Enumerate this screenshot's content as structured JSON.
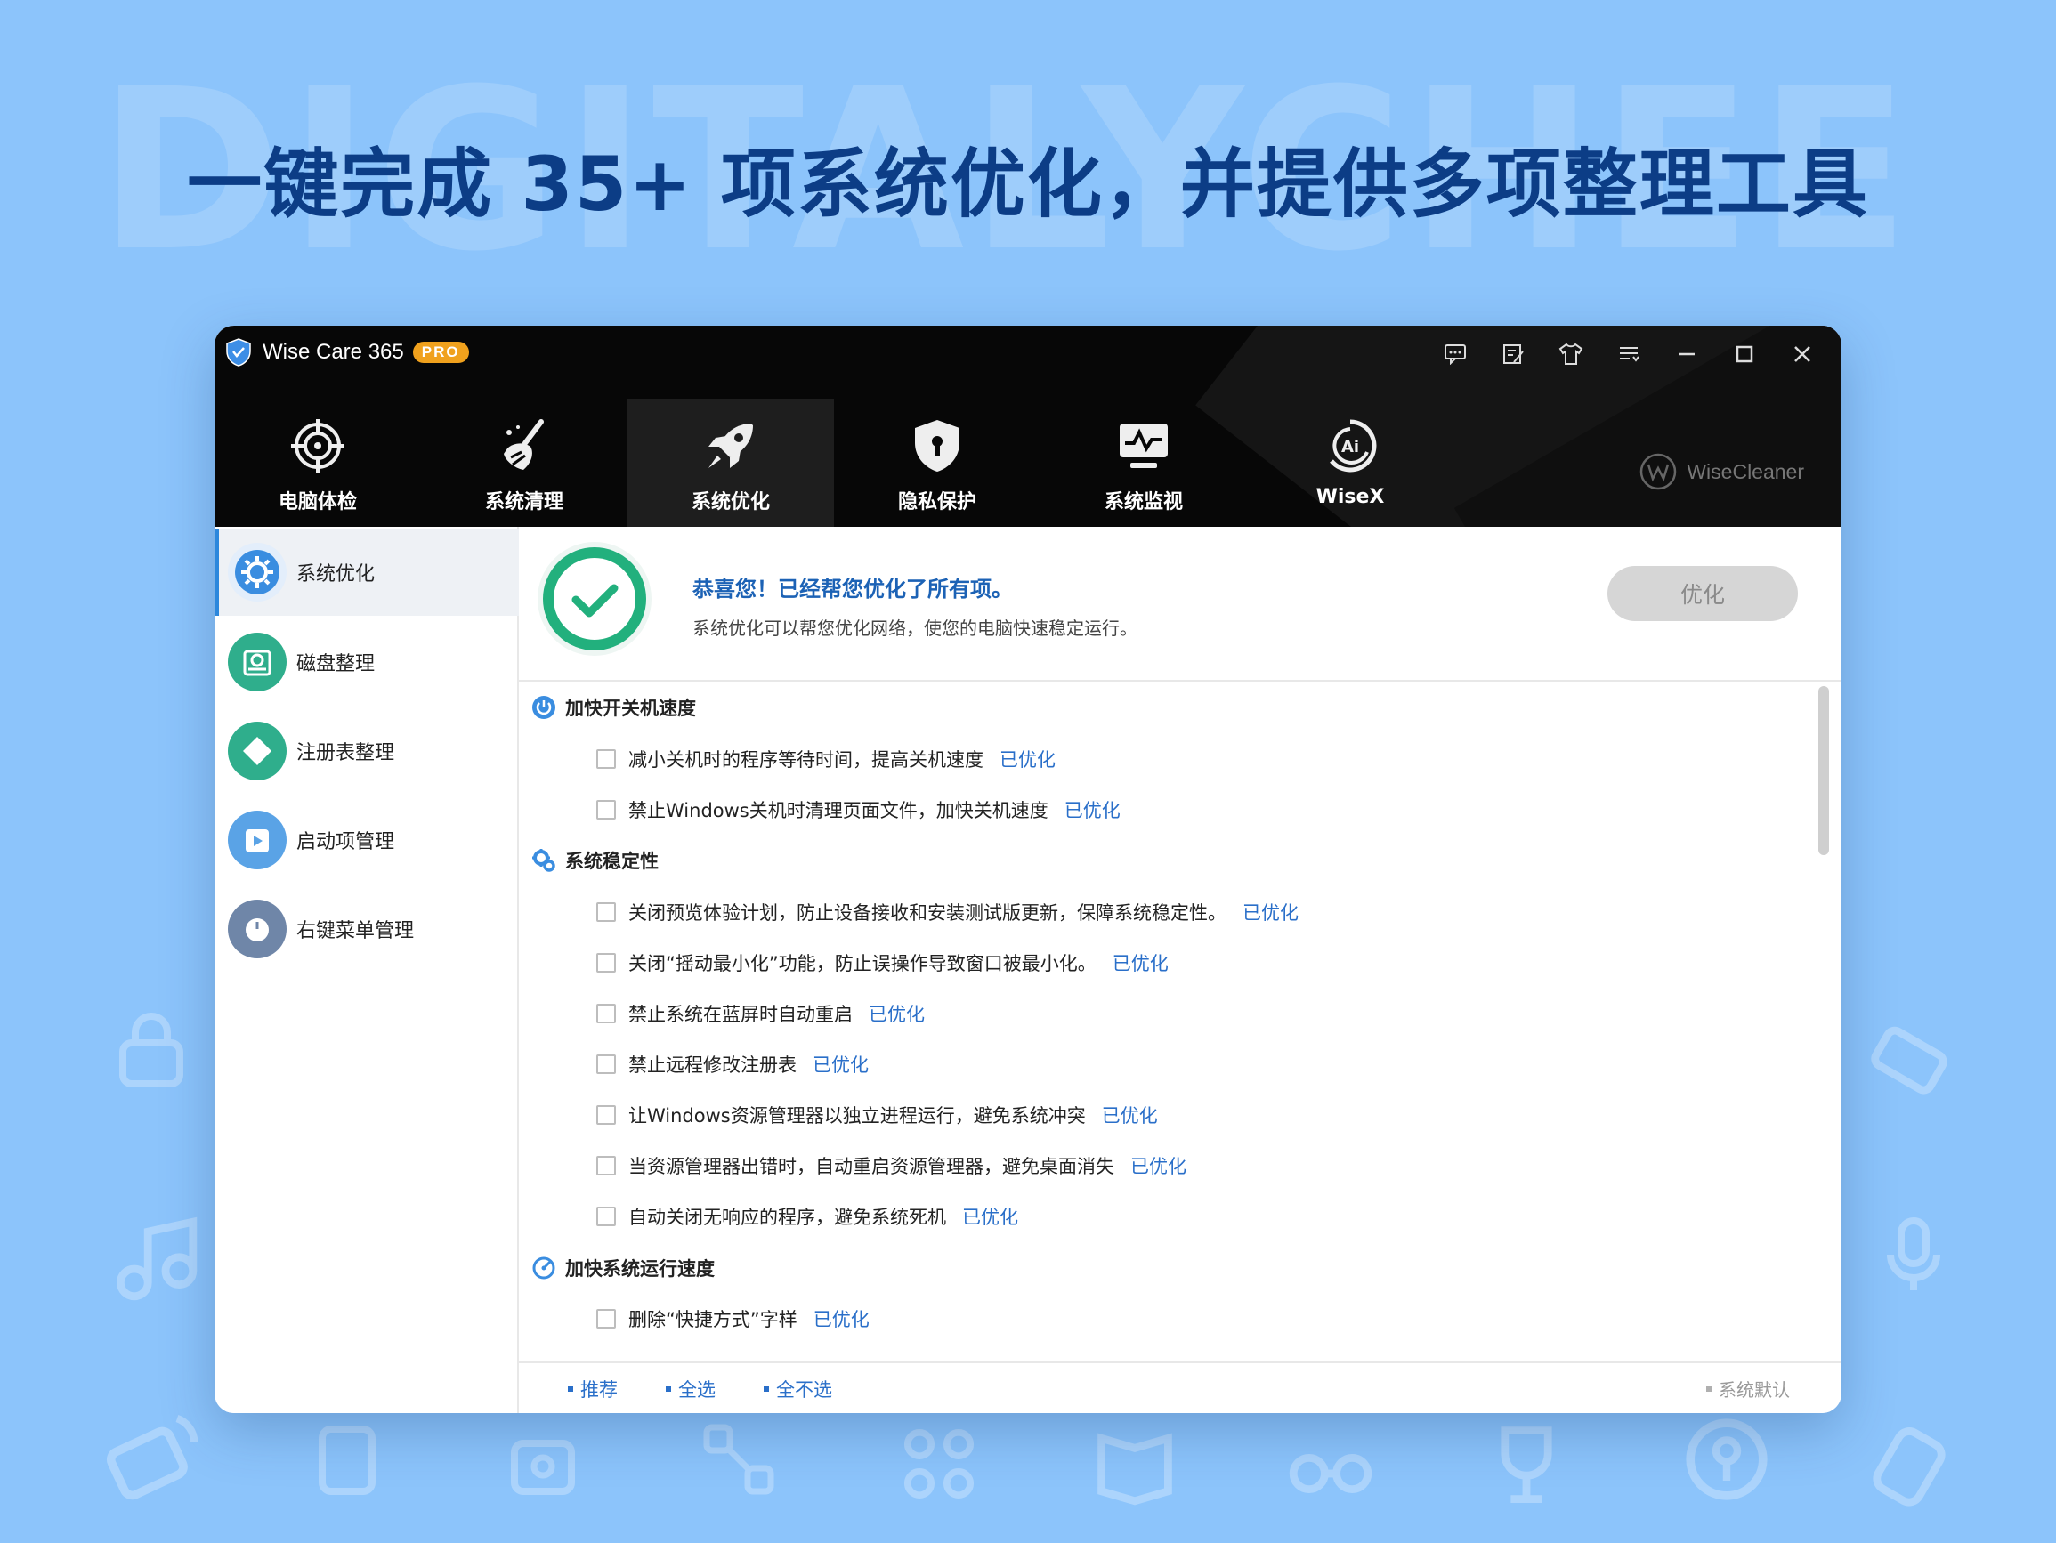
{
  "page": {
    "watermark": "DIGITALYCHEE",
    "headline": "一键完成 35+ 项系统优化，并提供多项整理工具"
  },
  "window": {
    "title": "Wise Care 365",
    "badge": "PRO",
    "controls": [
      "feedback-icon",
      "note-icon",
      "skin-icon",
      "menu-icon",
      "minimize-icon",
      "maximize-icon",
      "close-icon"
    ],
    "brand_logo_text": "WiseCleaner"
  },
  "nav": {
    "tabs": [
      {
        "label": "电脑体检",
        "icon": "target-icon"
      },
      {
        "label": "系统清理",
        "icon": "broom-icon"
      },
      {
        "label": "系统优化",
        "icon": "rocket-icon",
        "active": true
      },
      {
        "label": "隐私保护",
        "icon": "privacy-shield-icon"
      },
      {
        "label": "系统监视",
        "icon": "monitor-icon"
      },
      {
        "label": "WiseX",
        "icon": "ai-icon"
      }
    ]
  },
  "sidebar": {
    "items": [
      {
        "label": "系统优化",
        "color": "#3a8de0",
        "active": true
      },
      {
        "label": "磁盘整理",
        "color": "#2fae8c"
      },
      {
        "label": "注册表整理",
        "color": "#2fae8c"
      },
      {
        "label": "启动项管理",
        "color": "#5aa3e6"
      },
      {
        "label": "右键菜单管理",
        "color": "#6f86a8"
      }
    ]
  },
  "banner": {
    "title": "恭喜您！已经帮您优化了所有项。",
    "description": "系统优化可以帮您优化网络，使您的电脑快速稳定运行。",
    "button": "优化"
  },
  "sections": [
    {
      "title": "加快开关机速度",
      "items": [
        {
          "text": "减小关机时的程序等待时间，提高关机速度",
          "status": "已优化"
        },
        {
          "text": "禁止Windows关机时清理页面文件，加快关机速度",
          "status": "已优化"
        }
      ]
    },
    {
      "title": "系统稳定性",
      "items": [
        {
          "text": "关闭预览体验计划，防止设备接收和安装测试版更新，保障系统稳定性。",
          "status": "已优化"
        },
        {
          "text": "关闭“摇动最小化”功能，防止误操作导致窗口被最小化。",
          "status": "已优化"
        },
        {
          "text": "禁止系统在蓝屏时自动重启",
          "status": "已优化"
        },
        {
          "text": "禁止远程修改注册表",
          "status": "已优化"
        },
        {
          "text": "让Windows资源管理器以独立进程运行，避免系统冲突",
          "status": "已优化"
        },
        {
          "text": "当资源管理器出错时，自动重启资源管理器，避免桌面消失",
          "status": "已优化"
        },
        {
          "text": "自动关闭无响应的程序，避免系统死机",
          "status": "已优化"
        }
      ]
    },
    {
      "title": "加快系统运行速度",
      "items": [
        {
          "text": "删除“快捷方式”字样",
          "status": "已优化"
        }
      ]
    }
  ],
  "footer": {
    "recommend": "推荐",
    "select_all": "全选",
    "select_none": "全不选",
    "system_default": "系统默认"
  },
  "colors": {
    "page_bg": "#8cc4fb",
    "headline": "#0c3d86",
    "accent_blue": "#2a6fc9",
    "success_green": "#22b07d",
    "pro_orange": "#f0a11d"
  }
}
